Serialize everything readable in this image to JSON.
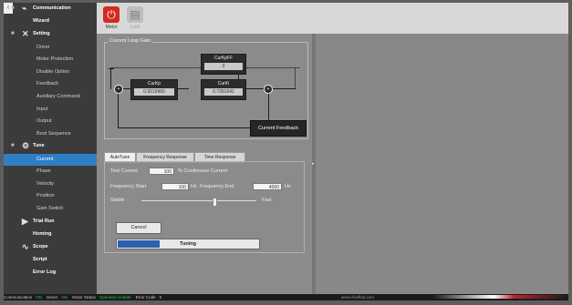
{
  "sidebar": {
    "collapse": "‹",
    "items": [
      {
        "label": "Communication",
        "kind": "grp",
        "icon": "plug-icon"
      },
      {
        "label": "Wizard",
        "kind": "grp2"
      },
      {
        "label": "Setting",
        "kind": "grp",
        "icon": "wrench-icon"
      },
      {
        "label": "Driver",
        "kind": "sub"
      },
      {
        "label": "Motor Protection",
        "kind": "sub"
      },
      {
        "label": "Disable Option",
        "kind": "sub"
      },
      {
        "label": "Feedback",
        "kind": "sub"
      },
      {
        "label": "Auxiliary Command",
        "kind": "sub"
      },
      {
        "label": "Input",
        "kind": "sub"
      },
      {
        "label": "Output",
        "kind": "sub"
      },
      {
        "label": "Boot Sequence",
        "kind": "sub"
      },
      {
        "label": "Tune",
        "kind": "grp",
        "icon": "tune-icon"
      },
      {
        "label": "Current",
        "kind": "sub",
        "active": true
      },
      {
        "label": "Phase",
        "kind": "sub"
      },
      {
        "label": "Velocity",
        "kind": "sub"
      },
      {
        "label": "Position",
        "kind": "sub"
      },
      {
        "label": "Gain Switch",
        "kind": "sub"
      },
      {
        "label": "Trial Run",
        "kind": "grp",
        "icon": "play-icon"
      },
      {
        "label": "Homing",
        "kind": "grp2"
      },
      {
        "label": "Scope",
        "kind": "grp",
        "icon": "scope-icon"
      },
      {
        "label": "Script",
        "kind": "grp2"
      },
      {
        "label": "Error Log",
        "kind": "grp2"
      }
    ]
  },
  "toolbar": {
    "motor_label": "Motor",
    "lock_label": "Lock",
    "power_glyph": "⏻",
    "lock_glyph": "▤"
  },
  "loop": {
    "title": "Current Loop Gain",
    "kpff_label": "CurKpFF",
    "kpff_value": "0",
    "kp_label": "CurKp",
    "kp_value": "0.9219960",
    "ki_label": "CurKi",
    "ki_value": "0.7391642",
    "feedback_label": "Current Feedback"
  },
  "tabs": [
    "AutoTune",
    "Frequency Response",
    "Time Response"
  ],
  "autotune": {
    "test_current_label": "Test Current",
    "test_current_value": "100",
    "test_current_unit": "% Continuous Current",
    "freq_start_label": "Frequency Start",
    "freq_start_value": "100",
    "freq_start_unit": "Hz",
    "freq_end_label": "Frequency End",
    "freq_end_value": "4000",
    "freq_end_unit": "Hz",
    "stable_label": "Stable",
    "fast_label": "Fast",
    "slider_level": 0.62,
    "cancel_label": "Cancel",
    "progress_label": "Tuning",
    "progress_fraction": 0.3
  },
  "status": {
    "communication_label": "Communication",
    "communication_value": "ON",
    "driver_label": "Driver",
    "driver_value": "ON",
    "motor_status_label": "Motor Status",
    "motor_status_value": "Operation enable",
    "error_label": "Error Code",
    "error_value": "0",
    "watermark": "www.chiefkat.com"
  },
  "colors": {
    "accent": "#2f7fc4",
    "power": "#d32b22",
    "progress": "#2c5fae",
    "status_ok": "#22cc44"
  }
}
